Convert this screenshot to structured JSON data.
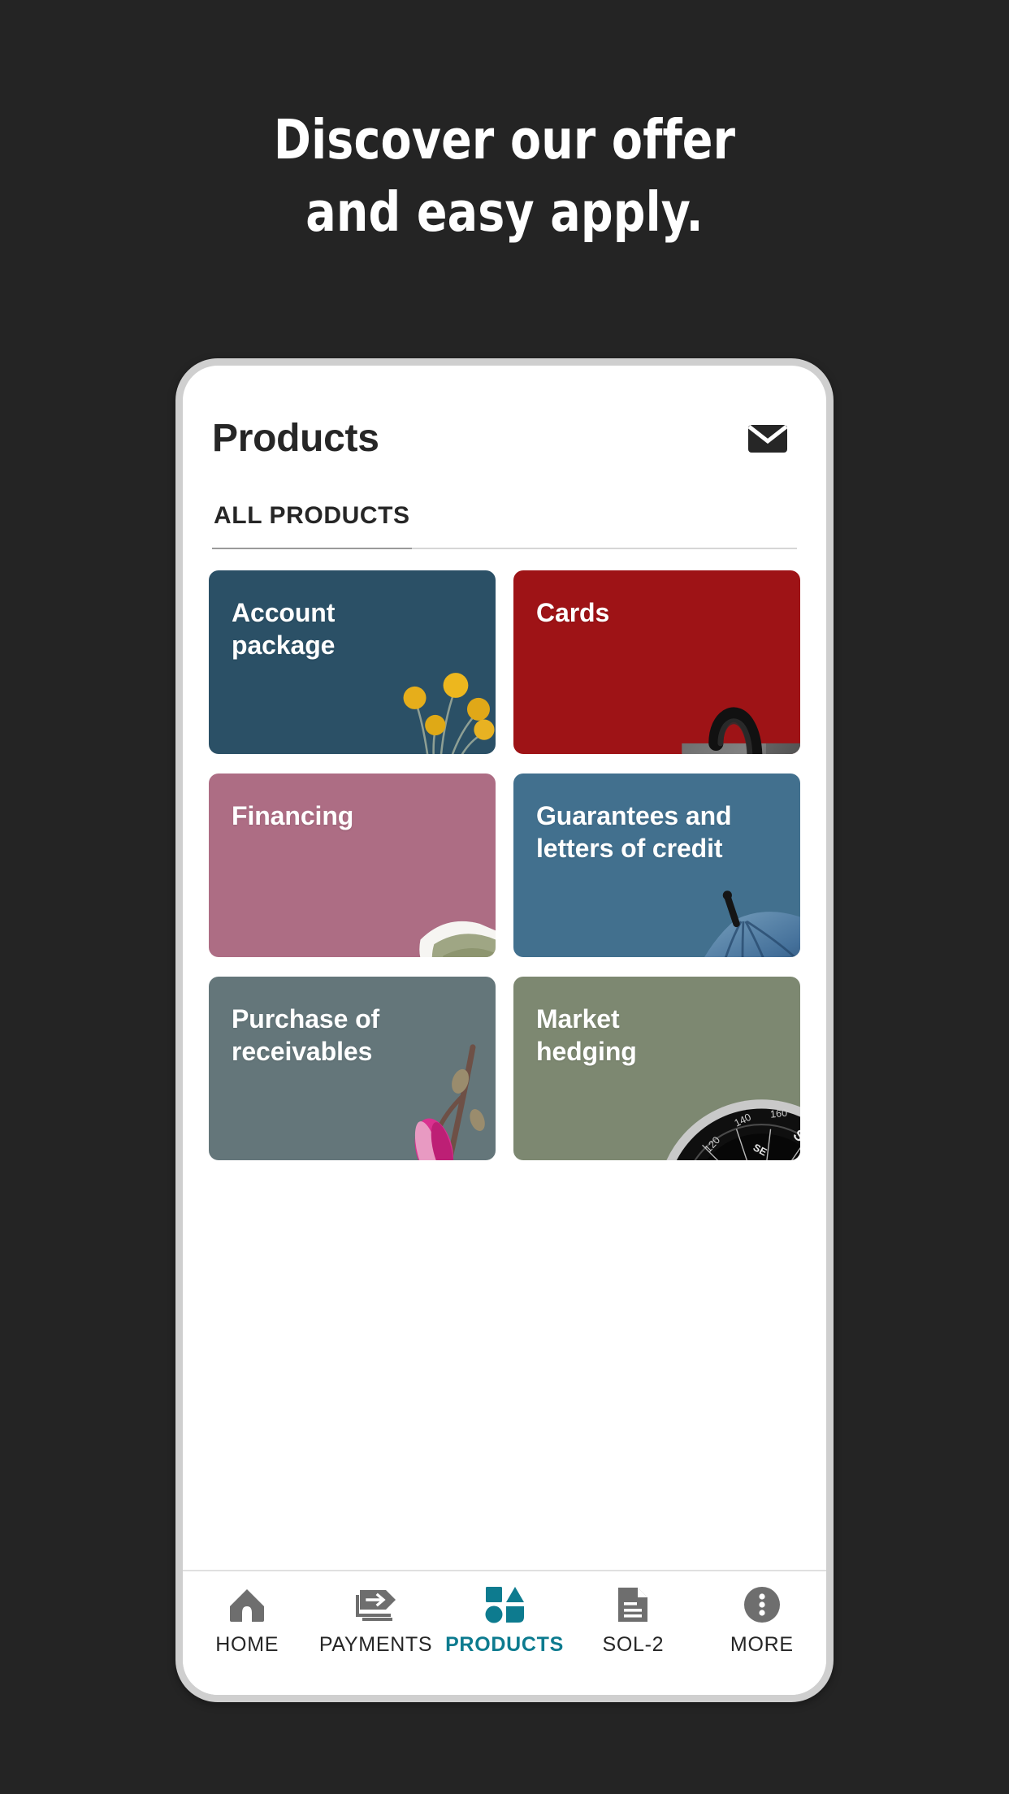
{
  "promo": {
    "headline_line1": "Discover our offer",
    "headline_line2": "and easy apply.",
    "background_color": "#242424",
    "text_color": "#ffffff"
  },
  "app": {
    "header": {
      "title": "Products",
      "mail_icon": "envelope-icon"
    },
    "tabs": [
      {
        "label": "ALL PRODUCTS",
        "active": true
      }
    ],
    "products": [
      {
        "label": "Account\npackage",
        "color": "#2b5066",
        "art": "yellow-craspedia-flowers-in-glass-vases"
      },
      {
        "label": "Cards",
        "color": "#9e1316",
        "art": "gray-shopping-bag-with-black-handles"
      },
      {
        "label": "Financing",
        "color": "#ad6d84",
        "art": "sofa-with-sage-green-pillows"
      },
      {
        "label": "Guarantees and\nletters of credit",
        "color": "#42708e",
        "art": "blue-umbrella"
      },
      {
        "label": "Purchase of\nreceivables",
        "color": "#64767a",
        "art": "magnolia-branch-with-pink-bud"
      },
      {
        "label": "Market\nhedging",
        "color": "#7d8871",
        "art": "black-compass"
      }
    ],
    "bottom_nav": {
      "active_color": "#0d7b8f",
      "inactive_color": "#6e6e6e",
      "items": [
        {
          "label": "HOME",
          "icon": "home-icon",
          "active": false
        },
        {
          "label": "PAYMENTS",
          "icon": "transfer-icon",
          "active": false
        },
        {
          "label": "PRODUCTS",
          "icon": "shapes-icon",
          "active": true
        },
        {
          "label": "SOL-2",
          "icon": "document-icon",
          "active": false
        },
        {
          "label": "MORE",
          "icon": "more-dots-icon",
          "active": false
        }
      ]
    }
  }
}
